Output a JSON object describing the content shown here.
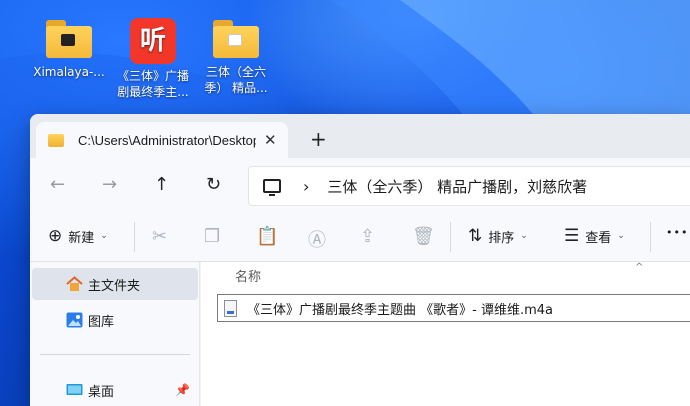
{
  "desktop": {
    "icons": [
      {
        "label": "Ximalaya-..."
      },
      {
        "label": "《三体》广播\n剧最终季主...",
        "app_glyph": "听"
      },
      {
        "label": "三体（全六\n季） 精品..."
      }
    ]
  },
  "window": {
    "tab": {
      "title": "C:\\Users\\Administrator\\Desktop",
      "close_glyph": "✕"
    },
    "new_tab_glyph": "+",
    "nav": {
      "back": "←",
      "forward": "→",
      "up": "↑",
      "refresh": "↻"
    },
    "address": {
      "separator": "›",
      "path": "三体（全六季） 精品广播剧，刘慈欣著"
    },
    "commands": {
      "new_glyph": "⊕",
      "new_label": "新建",
      "sort_glyph": "⇅",
      "sort_label": "排序",
      "view_glyph": "☰",
      "view_label": "查看",
      "more_glyph": "•••",
      "chevron": "⌄"
    },
    "sidebar": {
      "items": [
        {
          "label": "主文件夹"
        },
        {
          "label": "图库"
        },
        {
          "label": "桌面",
          "pin": "📌"
        }
      ]
    },
    "content": {
      "column_header": "名称",
      "sort_caret": "^",
      "files": [
        {
          "name": "《三体》广播剧最终季主题曲 《歌者》- 谭维维.m4a"
        }
      ]
    }
  },
  "colors": {
    "accent": "#0a45c9",
    "folder": "#f4b93a",
    "app_red": "#f3362a",
    "selection": "#dfe4ec"
  }
}
